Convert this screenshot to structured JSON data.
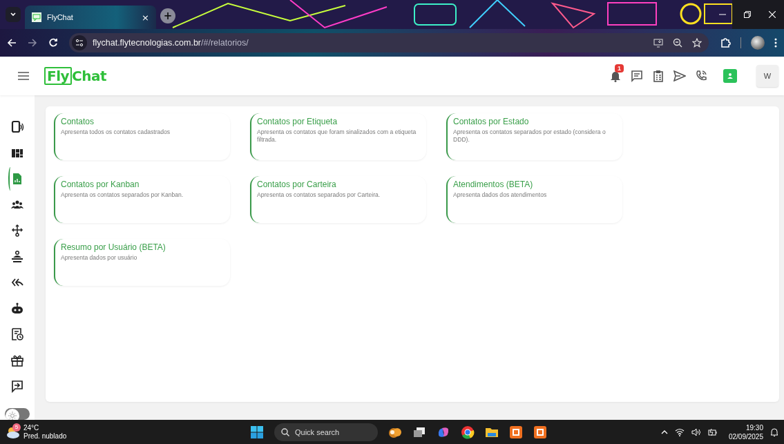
{
  "browser": {
    "tab": {
      "title": "FlyChat",
      "close": "×"
    },
    "new_tab": "+",
    "url_host": "flychat.flytecnologias.com.br",
    "url_path": "/#/relatorios/"
  },
  "header": {
    "logo": [
      "Fly",
      "Chat"
    ],
    "notification_count": "1",
    "avatar": "W"
  },
  "sidebar": {
    "items": [
      {
        "selected": false
      },
      {
        "selected": false
      },
      {
        "selected": true
      },
      {
        "selected": false
      },
      {
        "selected": false
      },
      {
        "selected": false
      },
      {
        "selected": false
      },
      {
        "selected": false
      },
      {
        "selected": false
      },
      {
        "selected": false
      },
      {
        "selected": false
      }
    ],
    "theme_toggle": {
      "on": false
    }
  },
  "reports": [
    {
      "title": "Contatos",
      "description": "Apresenta todos os contatos cadastrados"
    },
    {
      "title": "Contatos por Etiqueta",
      "description": "Apresenta os contatos que foram sinalizados com a etiqueta filtrada."
    },
    {
      "title": "Contatos por Estado",
      "description": "Apresenta os contatos separados por estado (considera o DDD)."
    },
    {
      "title": "Contatos por Kanban",
      "description": "Apresenta os contatos separados por Kanban."
    },
    {
      "title": "Contatos por Carteira",
      "description": "Apresenta os contatos separados por Carteira."
    },
    {
      "title": "Atendimentos (BETA)",
      "description": "Apresenta dados dos atendimentos"
    },
    {
      "title": "Resumo por Usuário (BETA)",
      "description": "Apresenta dados por usuário"
    }
  ],
  "taskbar": {
    "weather_badge": "5",
    "temperature": "24°C",
    "weather": "Pred. nublado",
    "search_placeholder": "Quick search",
    "time": "19:30",
    "date": "02/09/2025"
  }
}
